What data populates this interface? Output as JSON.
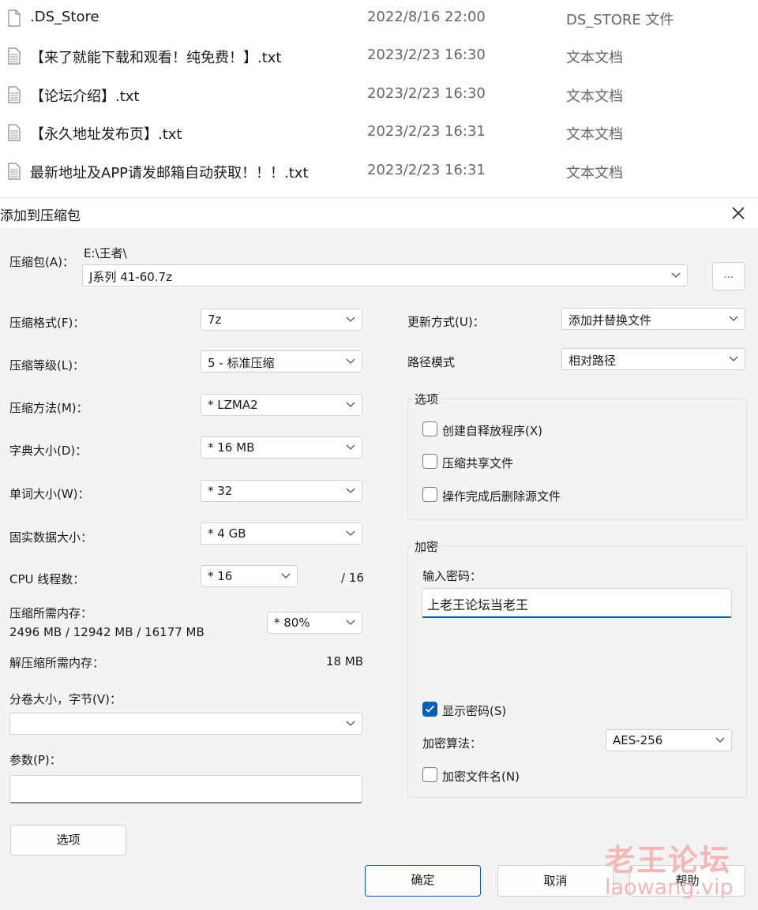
{
  "files": [
    {
      "name": ".DS_Store",
      "date": "2022/8/16 22:00",
      "type": "DS_STORE 文件"
    },
    {
      "name": "【来了就能下载和观看！纯免费！】.txt",
      "date": "2023/2/23 16:30",
      "type": "文本文档"
    },
    {
      "name": "【论坛介绍】.txt",
      "date": "2023/2/23 16:30",
      "type": "文本文档"
    },
    {
      "name": "【永久地址发布页】.txt",
      "date": "2023/2/23 16:31",
      "type": "文本文档"
    },
    {
      "name": "最新地址及APP请发邮箱自动获取！！！.txt",
      "date": "2023/2/23 16:31",
      "type": "文本文档"
    }
  ],
  "dialog": {
    "title": "添加到压缩包",
    "archive": {
      "label": "压缩包(A)：",
      "path": "E:\\王者\\",
      "value": "J系列 41-60.7z",
      "browse_label": "..."
    },
    "settings": [
      {
        "label": "压缩格式(F)：",
        "value": "7z"
      },
      {
        "label": "压缩等级(L)：",
        "value": "5 - 标准压缩"
      },
      {
        "label": "压缩方法(M)：",
        "value": "* LZMA2"
      },
      {
        "label": "字典大小(D)：",
        "value": "* 16 MB"
      },
      {
        "label": "单词大小(W)：",
        "value": "* 32"
      },
      {
        "label": "固实数据大小：",
        "value": "* 4 GB"
      }
    ],
    "cpu": {
      "label": "CPU 线程数：",
      "value": "* 16",
      "max": "/ 16"
    },
    "memory": {
      "label": "压缩所需内存：",
      "detail": "2496 MB / 12942 MB / 16177 MB",
      "value": "* 80%"
    },
    "decompress_memory": {
      "label": "解压缩所需内存：",
      "value": "18 MB"
    },
    "volume": {
      "label": "分卷大小，字节(V)：",
      "value": ""
    },
    "params": {
      "label": "参数(P)：",
      "value": ""
    },
    "options_button": "选项",
    "update_mode": {
      "label": "更新方式(U)：",
      "value": "添加并替换文件"
    },
    "path_mode": {
      "label": "路径模式",
      "value": "相对路径"
    },
    "options_group": {
      "title": "选项",
      "items": [
        {
          "label": "创建自释放程序(X)",
          "checked": false
        },
        {
          "label": "压缩共享文件",
          "checked": false
        },
        {
          "label": "操作完成后删除源文件",
          "checked": false
        }
      ]
    },
    "encryption": {
      "title": "加密",
      "password_label": "输入密码：",
      "password_value": "上老王论坛当老王",
      "show_password": {
        "label": "显示密码(S)",
        "checked": true
      },
      "method_label": "加密算法：",
      "method_value": "AES-256",
      "encrypt_names": {
        "label": "加密文件名(N)",
        "checked": false
      }
    },
    "buttons": {
      "ok": "确定",
      "cancel": "取消",
      "help": "帮助"
    }
  },
  "watermark": {
    "line1": "老王论坛",
    "line2": "laowang.vip"
  },
  "colors": {
    "accent": "#005fb8",
    "watermark": "#f2b8b8"
  }
}
